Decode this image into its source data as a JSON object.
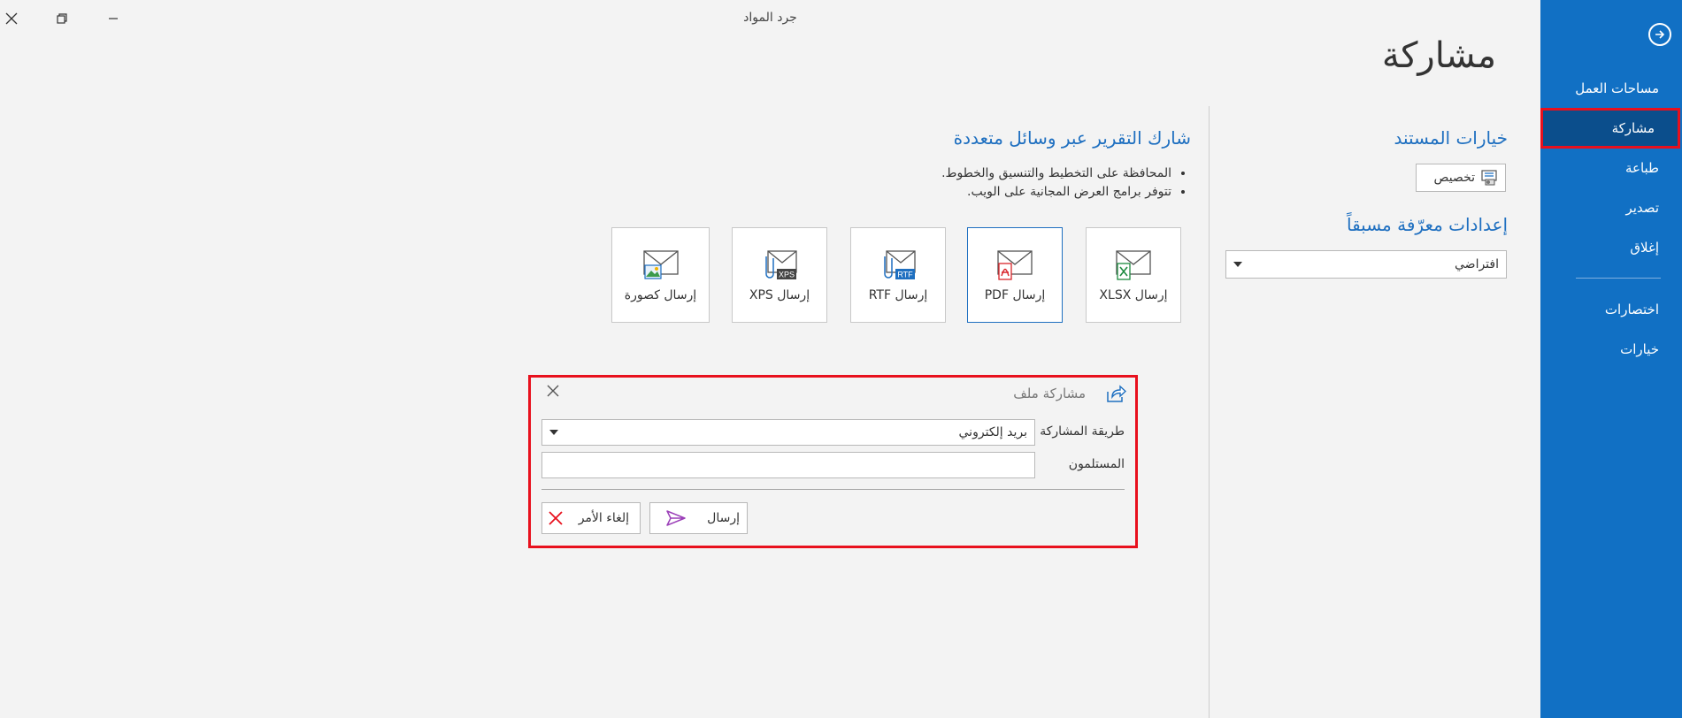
{
  "window": {
    "title": "جرد المواد"
  },
  "sidebar": {
    "items": [
      {
        "label": "مساحات العمل"
      },
      {
        "label": "مشاركة",
        "active": true
      },
      {
        "label": "طباعة"
      },
      {
        "label": "تصدير"
      },
      {
        "label": "إغلاق"
      },
      {
        "label": "اختصارات"
      },
      {
        "label": "خيارات"
      }
    ]
  },
  "page": {
    "title": "مشاركة"
  },
  "document_options": {
    "heading": "خيارات المستند",
    "customize_label": "تخصيص",
    "preset_heading": "إعدادات معرّفة مسبقاً",
    "preset_value": "افتراضي"
  },
  "share": {
    "heading": "شارك التقرير عبر وسائل متعددة",
    "bullets": [
      "المحافظة على التخطيط والتنسيق والخطوط.",
      "تتوفر برامج العرض المجانية على الويب."
    ],
    "tiles": [
      {
        "label": "إرسال XLSX",
        "icon": "xlsx-mail-icon"
      },
      {
        "label": "إرسال PDF",
        "icon": "pdf-mail-icon",
        "selected": true
      },
      {
        "label": "إرسال RTF",
        "icon": "rtf-mail-icon"
      },
      {
        "label": "إرسال XPS",
        "icon": "xps-mail-icon"
      },
      {
        "label": "إرسال كصورة",
        "icon": "image-mail-icon"
      }
    ]
  },
  "file_share_dialog": {
    "title": "مشاركة ملف",
    "method_label": "طريقة المشاركة",
    "method_value": "بريد إلكتروني",
    "recipients_label": "المستلمون",
    "recipients_value": "",
    "send_label": "إرسال",
    "cancel_label": "إلغاء الأمر"
  },
  "colors": {
    "sidebar": "#1170c4",
    "sidebar_active": "#0b4e8c",
    "accent_text": "#1e6fc0",
    "highlight_border": "#e8101d"
  }
}
